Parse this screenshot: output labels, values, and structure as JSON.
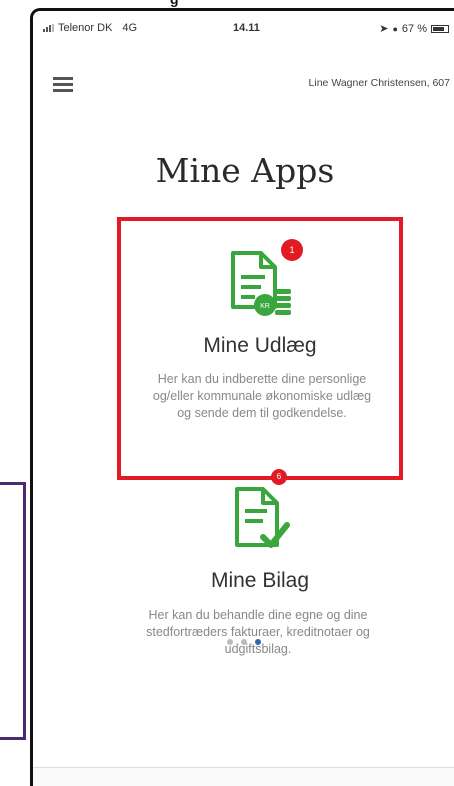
{
  "top_caption": "g",
  "status_bar": {
    "carrier": "Telenor DK",
    "network": "4G",
    "time": "14.11",
    "battery": "67 %"
  },
  "header": {
    "menu_icon": "hamburger-menu-icon",
    "user_name": "Line Wagner Christensen, 607"
  },
  "page_title": "Mine Apps",
  "apps": [
    {
      "title": "Mine Udlæg",
      "badge": "1",
      "icon": "document-kr-coins-icon",
      "description": "Her kan du indberette dine personlige og/eller kommunale økonomiske udlæg og sende dem til godkendelse.",
      "icon_label": "KR",
      "highlighted": true
    },
    {
      "title": "Mine Bilag",
      "badge": "6",
      "icon": "document-checkmark-icon",
      "description": "Her kan du behandle dine egne og dine stedfortræders fakturaer, kreditnotaer og udgiftsbilag.",
      "highlighted": false
    }
  ],
  "pager": {
    "total": 3,
    "active": 3
  },
  "colors": {
    "highlight_border": "#e01b24",
    "badge": "#e01b24",
    "icon_green": "#3aa63e",
    "active_dot": "#2b6cb0",
    "annotation_border": "#4b2a73"
  }
}
